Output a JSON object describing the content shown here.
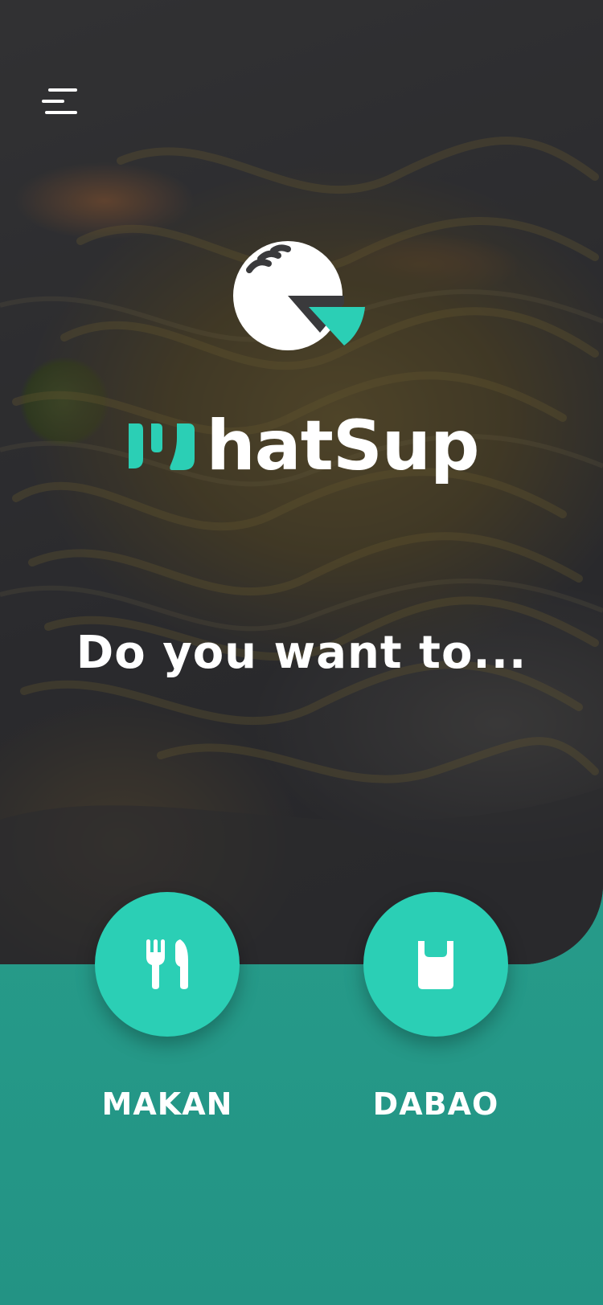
{
  "app": {
    "brand_name": "hatSup",
    "accent_color": "#2bcfb5",
    "background_color": "#2a9e8c"
  },
  "header": {
    "menu_icon": "hamburger-menu-icon"
  },
  "main": {
    "prompt": "Do you want to...",
    "logo_icon": "plate-logo-icon"
  },
  "actions": [
    {
      "label": "MAKAN",
      "icon": "fork-knife-icon"
    },
    {
      "label": "DABAO",
      "icon": "takeaway-bag-icon"
    }
  ]
}
